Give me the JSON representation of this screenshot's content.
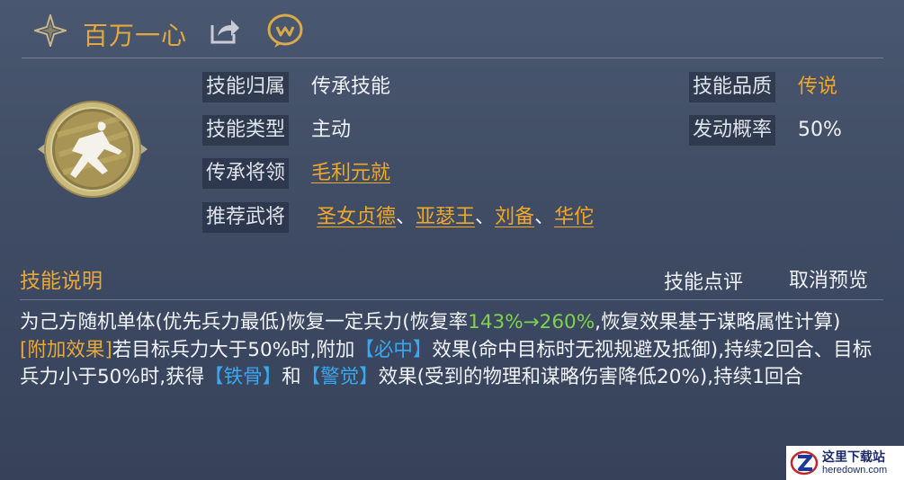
{
  "skill": {
    "name": "百万一心",
    "labels": {
      "ownership": "技能归属",
      "type": "技能类型",
      "general": "传承将领",
      "recommended": "推荐武将",
      "quality": "技能品质",
      "chance": "发动概率"
    },
    "ownership": "传承技能",
    "type": "主动",
    "general": "毛利元就",
    "recommended": [
      "圣女贞德",
      "亚瑟王",
      "刘备",
      "华佗"
    ],
    "separator": "、",
    "quality": "传说",
    "chance": "50%"
  },
  "section": {
    "title": "技能说明",
    "review": "技能点评",
    "cancel_preview": "取消预览"
  },
  "description": {
    "p1_a": "为己方随机单体(优先兵力最低)恢复一定兵力(恢复率",
    "p1_rate": "143%→260%",
    "p1_b": ",恢复效果基于谋略属性计算)",
    "p2_tag": "[附加效果]",
    "p2_a": "若目标兵力大于50%时,附加",
    "p2_effect1": "【必中】",
    "p2_b": "效果(命中目标时无视规避及抵御),持续2回合、目标兵力小于50%时,获得",
    "p2_effect2": "【铁骨】",
    "p2_c": "和",
    "p2_effect3": "【警觉】",
    "p2_d": "效果(受到的物理和谋略伤害降低20%),持续1回合"
  },
  "watermark": {
    "line1": "这里下载站",
    "line2": "heredown.com"
  },
  "colors": {
    "gold": "#f0a828",
    "green": "#7fd24f",
    "blue": "#3aa8f0",
    "background": "#434f68"
  }
}
